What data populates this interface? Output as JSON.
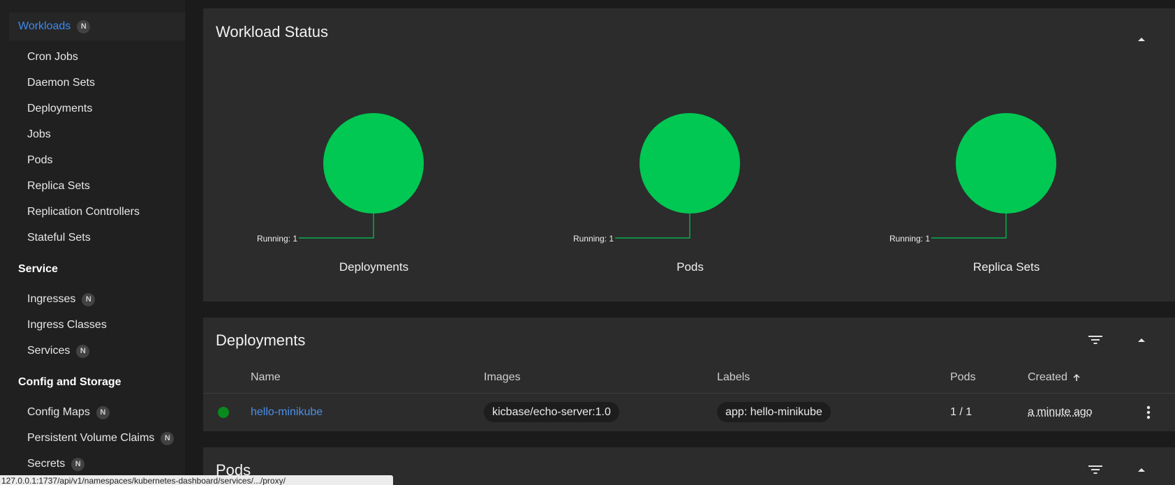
{
  "sidebar": {
    "workloads": {
      "label": "Workloads",
      "badge": "N"
    },
    "workload_items": [
      "Cron Jobs",
      "Daemon Sets",
      "Deployments",
      "Jobs",
      "Pods",
      "Replica Sets",
      "Replication Controllers",
      "Stateful Sets"
    ],
    "service": {
      "label": "Service",
      "items": [
        {
          "label": "Ingresses",
          "badge": "N"
        },
        {
          "label": "Ingress Classes",
          "badge": ""
        },
        {
          "label": "Services",
          "badge": "N"
        }
      ]
    },
    "config": {
      "label": "Config and Storage",
      "items": [
        {
          "label": "Config Maps",
          "badge": "N"
        },
        {
          "label": "Persistent Volume Claims",
          "badge": "N"
        },
        {
          "label": "Secrets",
          "badge": "N"
        }
      ]
    }
  },
  "workload_status": {
    "title": "Workload Status",
    "charts": [
      {
        "label": "Deployments",
        "running_text": "Running: 1",
        "running": 1
      },
      {
        "label": "Pods",
        "running_text": "Running: 1",
        "running": 1
      },
      {
        "label": "Replica Sets",
        "running_text": "Running: 1",
        "running": 1
      }
    ],
    "running_color": "#00c853"
  },
  "deployments": {
    "title": "Deployments",
    "columns": {
      "name": "Name",
      "images": "Images",
      "labels": "Labels",
      "pods": "Pods",
      "created": "Created"
    },
    "rows": [
      {
        "status_color": "#0a8a1d",
        "name": "hello-minikube",
        "image": "kicbase/echo-server:1.0",
        "label": "app: hello-minikube",
        "pods": "1 / 1",
        "created": "a minute ago"
      }
    ]
  },
  "pods": {
    "title": "Pods"
  },
  "icons": {
    "collapse": "chevron-up-icon",
    "filter": "filter-icon",
    "more": "more-vert-icon",
    "sort": "arrow-up-icon"
  },
  "statusbar": {
    "url": "127.0.0.1:1737/api/v1/namespaces/kubernetes-dashboard/services/.../proxy/"
  }
}
